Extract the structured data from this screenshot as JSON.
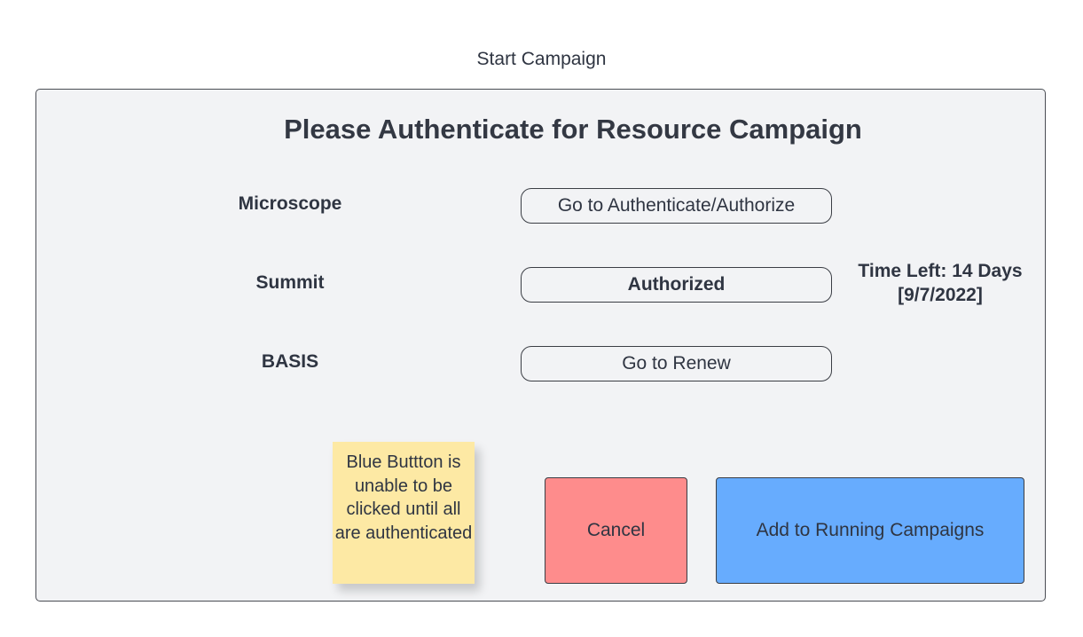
{
  "window": {
    "title": "Start Campaign"
  },
  "dialog": {
    "heading": "Please Authenticate for Resource Campaign",
    "resources": [
      {
        "label": "Microscope",
        "button_label": "Go to Authenticate/Authorize"
      },
      {
        "label": "Summit",
        "button_label": "Authorized"
      },
      {
        "label": "BASIS",
        "button_label": "Go to Renew"
      }
    ],
    "summit_time_left": {
      "line1": "Time Left: 14 Days",
      "line2": "[9/7/2022]"
    },
    "note": {
      "text": "Blue Buttton is unable to be clicked until all are authenticated",
      "color": "#fde9a4"
    },
    "actions": {
      "cancel_label": "Cancel",
      "cancel_color": "#fe8c8c",
      "add_label": "Add to Running Campaigns",
      "add_color": "#67acfe"
    }
  }
}
